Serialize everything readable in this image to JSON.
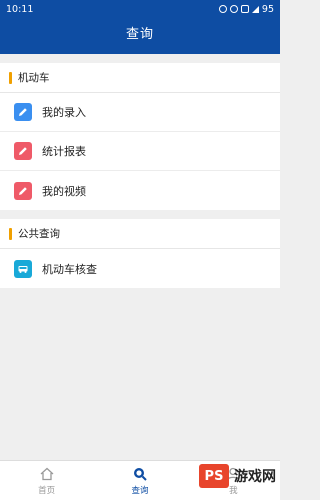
{
  "status_bar": {
    "time": "10:11",
    "battery": "95"
  },
  "header": {
    "title": "查询"
  },
  "sections": [
    {
      "title": "机动车",
      "items": [
        {
          "label": "我的录入",
          "icon": "edit-icon",
          "color": "#3a8ff0"
        },
        {
          "label": "统计报表",
          "icon": "edit-icon",
          "color": "#ef5a68"
        },
        {
          "label": "我的视频",
          "icon": "edit-icon",
          "color": "#ef5a68"
        }
      ]
    },
    {
      "title": "公共查询",
      "items": [
        {
          "label": "机动车核查",
          "icon": "bus-icon",
          "color": "#19a9d8"
        }
      ]
    }
  ],
  "bottom_nav": [
    {
      "label": "首页",
      "icon": "home-icon",
      "active": false
    },
    {
      "label": "查询",
      "icon": "search-icon",
      "active": true
    },
    {
      "label": "我",
      "icon": "user-icon",
      "active": false
    }
  ],
  "watermark": {
    "logo": "PS",
    "text": "游戏网"
  },
  "colors": {
    "header": "#0e4da3",
    "accent_bar": "#f0a000"
  }
}
